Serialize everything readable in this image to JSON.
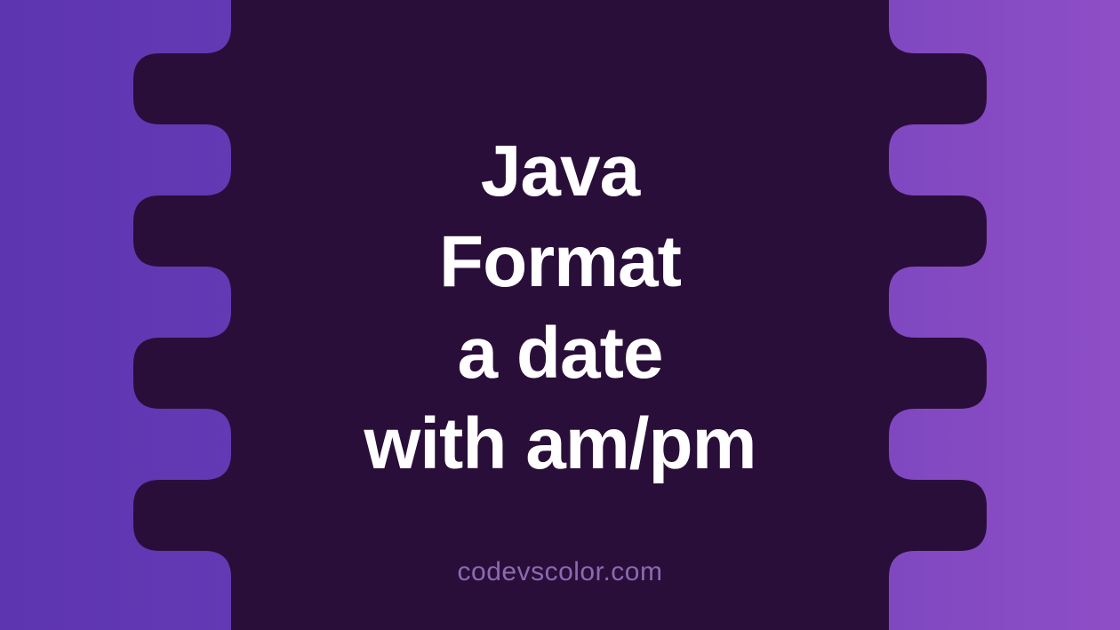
{
  "title": {
    "line1": "Java",
    "line2": "Format",
    "line3": "a date",
    "line4": "with am/pm"
  },
  "watermark": "codevscolor.com",
  "colors": {
    "bg_left": "#5e35b1",
    "bg_right": "#8e4ec6",
    "blob": "#2a0e3a",
    "text": "#ffffff",
    "watermark": "#8a6bb0"
  }
}
